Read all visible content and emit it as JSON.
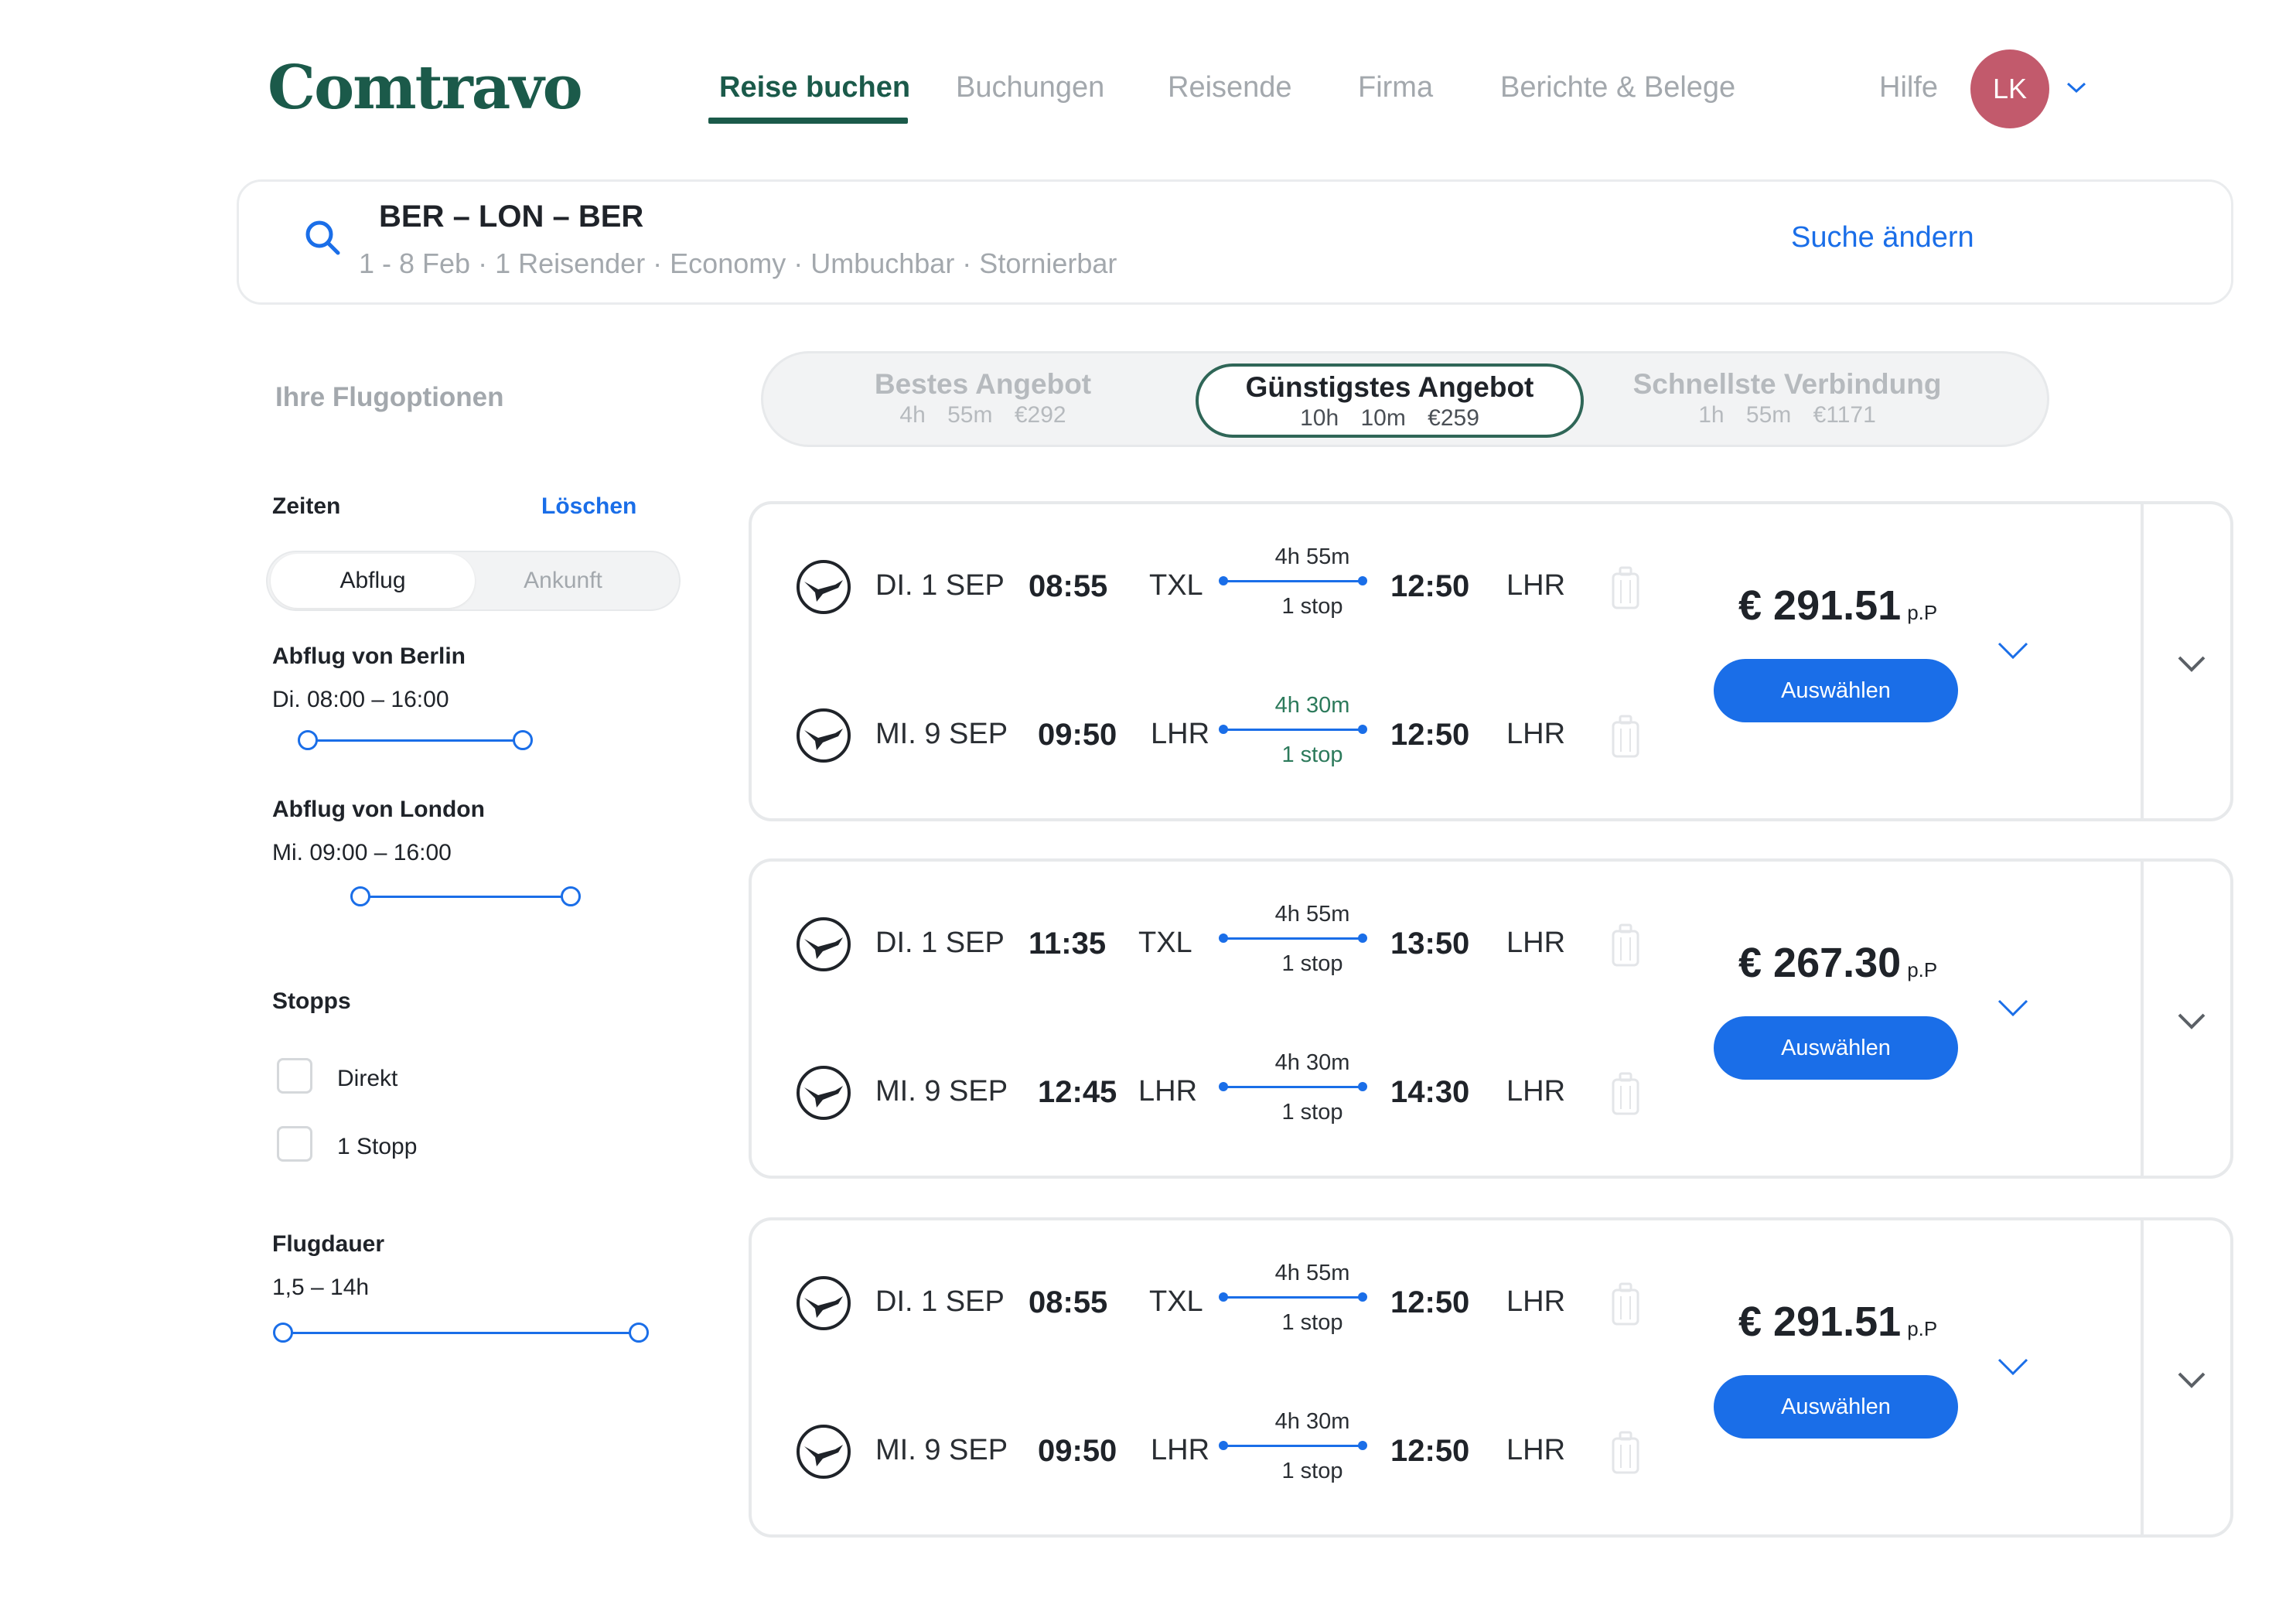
{
  "header": {
    "logo": "Comtravo",
    "nav": [
      "Reise buchen",
      "Buchungen",
      "Reisende",
      "Firma",
      "Berichte & Belege"
    ],
    "help": "Hilfe",
    "avatar_initials": "LK",
    "brand_color": "#1b5a4a",
    "accent_color": "#1a6ee8",
    "avatar_color": "#c25a6c"
  },
  "search": {
    "route": "BER – LON – BER",
    "meta": "1 - 8 Feb · 1 Reisender ·  Economy · Umbuchbar · Stornierbar",
    "change_label": "Suche ändern",
    "icon": "search-icon"
  },
  "sort": {
    "tabs": [
      {
        "label": "Bestes Angebot",
        "sub": "4h 55m €292"
      },
      {
        "label": "Günstigstes Angebot",
        "sub": "10h 10m €259",
        "active": true
      },
      {
        "label": "Schnellste Verbindung",
        "sub": "1h 55m €1171"
      }
    ]
  },
  "filters": {
    "title": "Ihre Flugoptionen",
    "times_label": "Zeiten",
    "clear_label": "Löschen",
    "toggle": [
      "Abflug",
      "Ankunft"
    ],
    "berlin_label": "Abflug von Berlin",
    "berlin_range": "Di. 08:00 – 16:00",
    "london_label": "Abflug von London",
    "london_range": "Mi. 09:00 – 16:00",
    "stops_label": "Stopps",
    "stops_options": [
      "Direkt",
      "1 Stopp"
    ],
    "duration_label": "Flugdauer",
    "duration_range": "1,5 – 14h"
  },
  "results": [
    {
      "outbound": {
        "date": "DI. 1 SEP",
        "dep": "08:55",
        "from": "TXL",
        "duration": "4h 55m",
        "stops": "1 stop",
        "arr": "12:50",
        "to": "LHR"
      },
      "inbound": {
        "date": "MI. 9 SEP",
        "dep": "09:50",
        "from": "LHR",
        "duration": "4h 30m",
        "stops": "1 stop",
        "arr": "12:50",
        "to": "LHR"
      },
      "price": "€ 291.51",
      "pp": "p.P",
      "select_label": "Auswählen"
    },
    {
      "outbound": {
        "date": "DI. 1 SEP",
        "dep": "11:35",
        "from": "TXL",
        "duration": "4h 55m",
        "stops": "1 stop",
        "arr": "13:50",
        "to": "LHR"
      },
      "inbound": {
        "date": "MI. 9 SEP",
        "dep": "12:45",
        "from": "LHR",
        "duration": "4h 30m",
        "stops": "1 stop",
        "arr": "14:30",
        "to": "LHR"
      },
      "price": "€ 267.30",
      "pp": "p.P",
      "select_label": "Auswählen"
    },
    {
      "outbound": {
        "date": "DI. 1 SEP",
        "dep": "08:55",
        "from": "TXL",
        "duration": "4h 55m",
        "stops": "1 stop",
        "arr": "12:50",
        "to": "LHR"
      },
      "inbound": {
        "date": "MI. 9 SEP",
        "dep": "09:50",
        "from": "LHR",
        "duration": "4h 30m",
        "stops": "1 stop",
        "arr": "12:50",
        "to": "LHR"
      },
      "price": "€ 291.51",
      "pp": "p.P",
      "select_label": "Auswählen"
    }
  ]
}
